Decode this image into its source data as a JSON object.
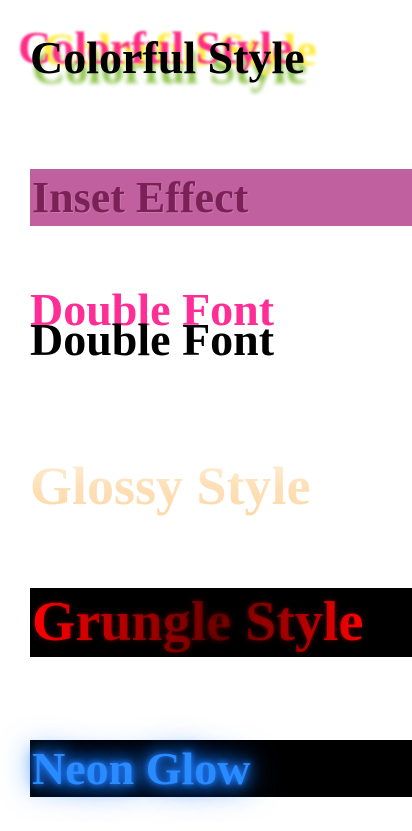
{
  "items": {
    "colorful": "Colorful Style",
    "inset": "Inset Effect",
    "double_back": "Double Font",
    "double_front": "Double Font",
    "glossy": "Glossy Style",
    "grunge": "Grungle Style",
    "neon": "Neon Glow"
  },
  "colors": {
    "pink": "#ff2d86",
    "yellow": "#ffeb3b",
    "green": "#8bc34a",
    "inset_bg": "#c1609f",
    "inset_text": "#7b2158",
    "double_pink": "#ff2e97",
    "glossy": "#fde4bf",
    "grunge_red": "#ff0000",
    "neon_blue": "#2a8bff"
  }
}
